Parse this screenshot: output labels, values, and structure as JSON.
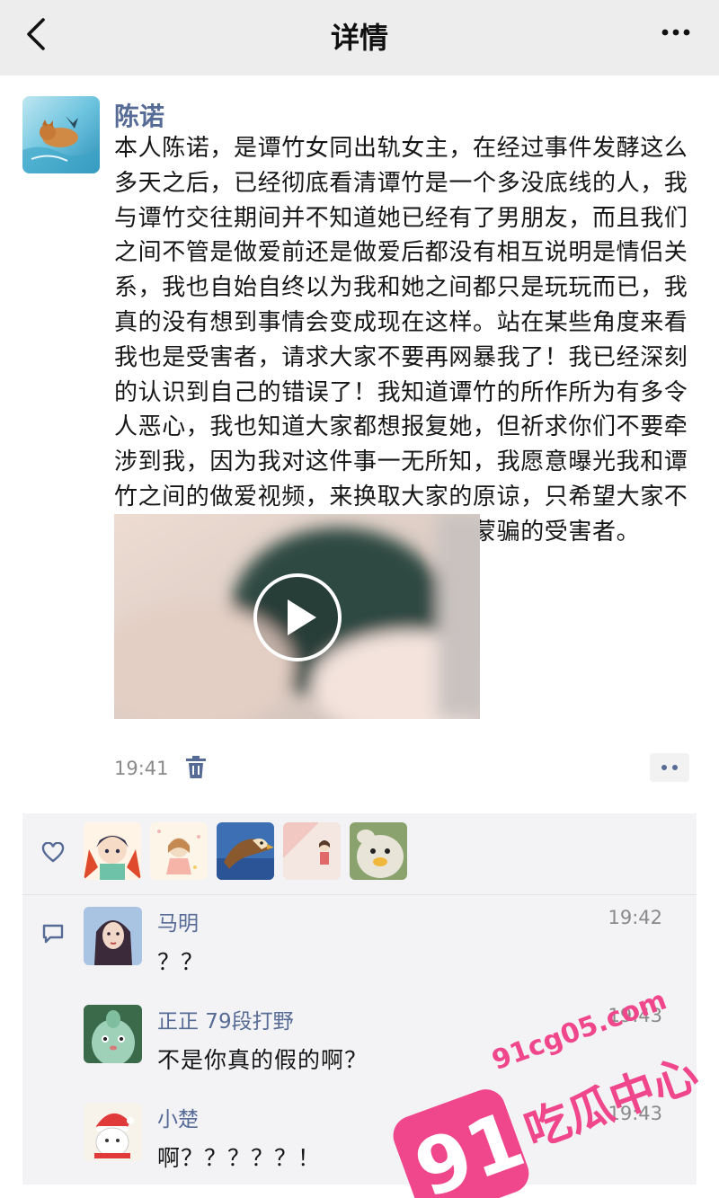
{
  "header": {
    "title": "详情",
    "back_icon": "chevron-left-icon",
    "more_icon": "ellipsis-icon"
  },
  "post": {
    "author": "陈诺",
    "text_lines": [
      "本人陈诺，是谭竹女同出轨女主，在经过事件发酵这么",
      "多天之后，已经彻底看清谭竹是一个多没底线的人，我",
      "与谭竹交往期间并不知道她已经有了男朋友，而且我们",
      "之间不管是做爱前还是做爱后都没有相互说明是情侣关",
      "系，我也自始自终以为我和她之间都只是玩玩而已，我",
      "真的没有想到事情会变成现在这样。站在某些角度来看",
      "我也是受害者，请求大家不要再网暴我了！我已经深刻",
      "的认识到自己的错误了！我知道谭竹的所作所为有多令",
      "人恶心，我也知道大家都想报复她，但祈求你们不要牵",
      "涉到我，因为我对这件事一无所知，我愿意曝光我和谭",
      "竹之间的做爱视频，来换取大家的原谅，只希望大家不",
      "要再网暴我了！因为我也是一个被蒙骗的受害者。"
    ],
    "time": "19:41",
    "delete_icon": "trash-icon",
    "more_icon": "dots-icon"
  },
  "likes": {
    "icon": "heart-outline-icon",
    "count": 5
  },
  "comments": [
    {
      "name": "马明",
      "time": "19:42",
      "text": "？？"
    },
    {
      "name": "正正 79段打野",
      "time": "19:43",
      "text": "不是你真的假的啊？"
    },
    {
      "name": "小楚",
      "time": "19:43",
      "text": "啊？？？？？！"
    }
  ],
  "watermark": {
    "number": "91",
    "domain": "91cg05.com",
    "label": "吃瓜中心",
    "color": "#f0468c"
  }
}
